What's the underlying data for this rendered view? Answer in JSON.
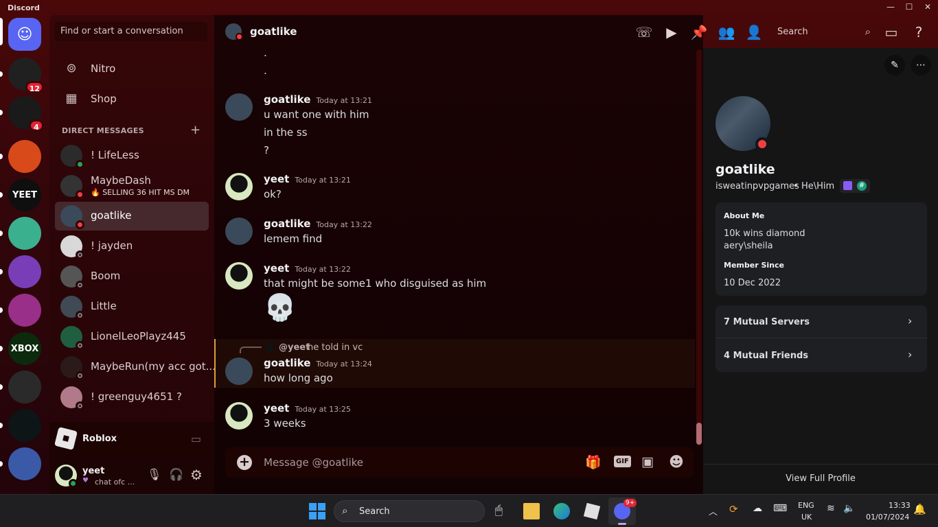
{
  "window": {
    "title": "Discord",
    "min": "—",
    "max": "☐",
    "close": "✕"
  },
  "servers": [
    {
      "name": "discord-home",
      "bg": "#5865f2",
      "badge": ""
    },
    {
      "name": "server-1",
      "bg": "#202020",
      "badge": "12"
    },
    {
      "name": "server-2",
      "bg": "#1a1a1a",
      "badge": "4"
    },
    {
      "name": "server-3",
      "bg": "#d84a1a",
      "badge": ""
    },
    {
      "name": "server-4",
      "bg": "#0f0f0f",
      "badge": "",
      "text": "YEET"
    },
    {
      "name": "server-5",
      "bg": "#3bb08f",
      "badge": ""
    },
    {
      "name": "server-6",
      "bg": "#7a3db8",
      "badge": ""
    },
    {
      "name": "server-7",
      "bg": "#9a2f8a",
      "badge": ""
    },
    {
      "name": "server-8",
      "bg": "#0c2a0c",
      "badge": "",
      "text": "XBOX"
    },
    {
      "name": "server-9",
      "bg": "#2a2a2a",
      "badge": ""
    },
    {
      "name": "server-10",
      "bg": "#0d1517",
      "badge": ""
    },
    {
      "name": "server-11",
      "bg": "#3a5aa8",
      "badge": ""
    }
  ],
  "dm": {
    "search_placeholder": "Find or start a conversation",
    "nav": [
      {
        "label": "Nitro",
        "icon": "nitro-icon"
      },
      {
        "label": "Shop",
        "icon": "shop-icon"
      }
    ],
    "section_title": "DIRECT MESSAGES",
    "section_plus": "+",
    "conversations": [
      {
        "name": "! LifeLess",
        "status": "on",
        "sub": "",
        "color": "#2b2b2b"
      },
      {
        "name": "MaybeDash",
        "status": "dnd",
        "sub": "🔥 SELLING 36 HIT MS DM",
        "color": "#333"
      },
      {
        "name": "goatlike",
        "status": "dnd",
        "sub": "",
        "color": "#3a4a5a",
        "selected": true
      },
      {
        "name": "! jayden",
        "status": "off",
        "sub": "",
        "color": "#d8d8d8"
      },
      {
        "name": "Boom",
        "status": "off",
        "sub": "",
        "color": "#555"
      },
      {
        "name": "Little",
        "status": "off",
        "sub": "",
        "color": "#404a55"
      },
      {
        "name": "LionelLeoPlayz445",
        "status": "off",
        "sub": "",
        "color": "#1f5f3f"
      },
      {
        "name": "MaybeRun(my acc got...",
        "status": "off",
        "sub": "",
        "color": "#2a1a1a"
      },
      {
        "name": "! greenguy4651 ?",
        "status": "off",
        "sub": "",
        "color": "#b07a8a"
      }
    ],
    "activity": "Roblox",
    "user": {
      "name": "yeet",
      "status": "chat ofc ..."
    }
  },
  "chat": {
    "recipient": "goatlike",
    "search": "Search",
    "input_placeholder": "Message @goatlike",
    "dots": [
      ".",
      "."
    ],
    "messages": [
      {
        "author": "goatlike",
        "time": "Today at 13:21",
        "lines": [
          "u want one with him",
          "in the ss",
          "?"
        ]
      },
      {
        "author": "yeet",
        "time": "Today at 13:21",
        "lines": [
          "ok?"
        ]
      },
      {
        "author": "goatlike",
        "time": "Today at 13:22",
        "lines": [
          "lemem find"
        ]
      },
      {
        "author": "yeet",
        "time": "Today at 13:22",
        "lines": [
          "that might be some1 who disguised as him"
        ],
        "emoji": "💀"
      },
      {
        "author": "goatlike",
        "time": "Today at 13:24",
        "lines": [
          "how long ago"
        ],
        "reply_to": "@yeet",
        "reply_text": "he told in vc"
      },
      {
        "author": "yeet",
        "time": "Today at 13:25",
        "lines": [
          "3 weeks"
        ]
      }
    ]
  },
  "profile": {
    "name": "goatlike",
    "username": "isweatinpvpgames",
    "pronouns": "He\\Him",
    "about_title": "About Me",
    "about_lines": [
      "10k wins diamond",
      "aery\\sheila"
    ],
    "member_since_title": "Member Since",
    "member_since": "10 Dec 2022",
    "mutual_servers": "7 Mutual Servers",
    "mutual_friends": "4 Mutual Friends",
    "view_full": "View Full Profile"
  },
  "taskbar": {
    "search": "Search",
    "lang": "ENG",
    "region": "UK",
    "time": "13:33",
    "date": "01/07/2024",
    "discord_badge": "9+"
  }
}
